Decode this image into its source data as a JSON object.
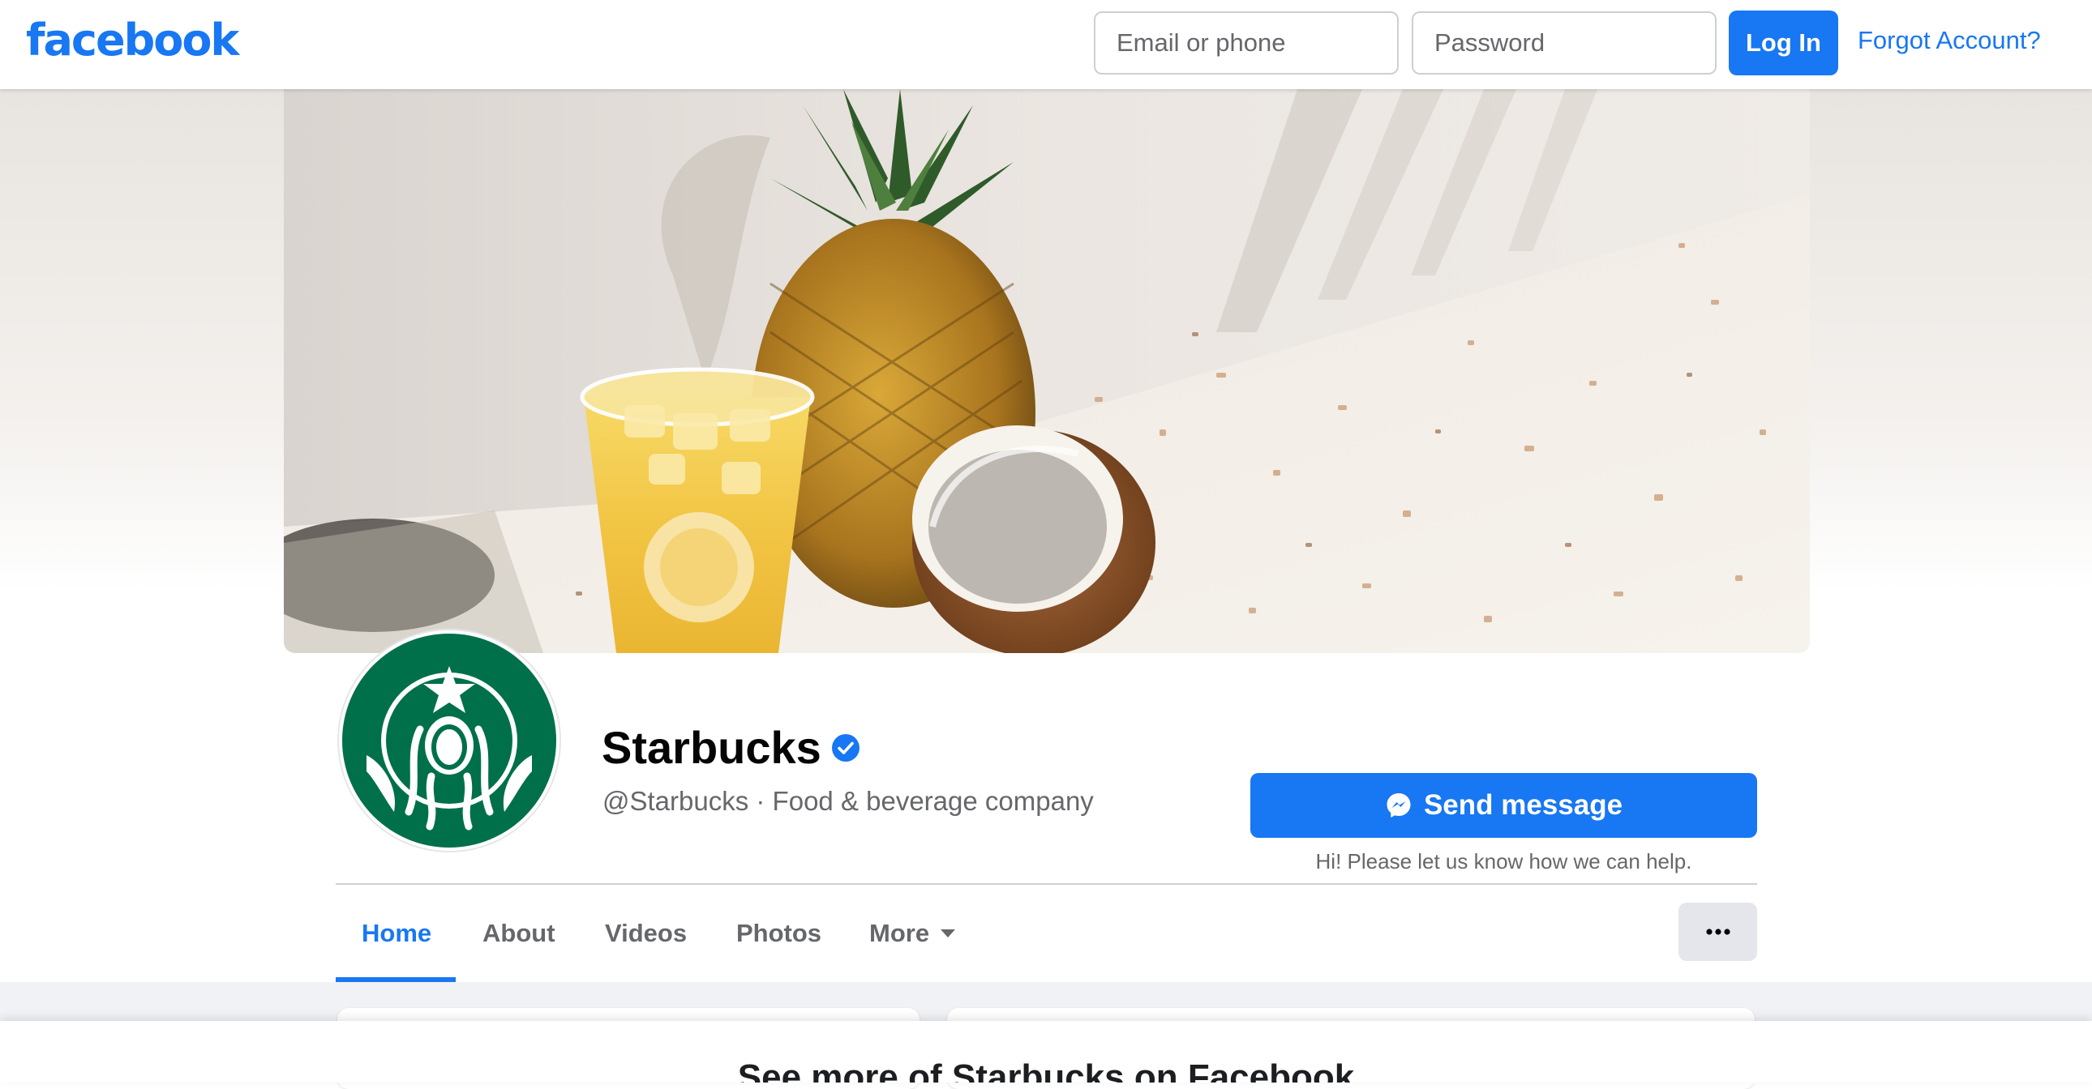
{
  "header": {
    "logo": "facebook",
    "email_placeholder": "Email or phone",
    "password_placeholder": "Password",
    "login_label": "Log In",
    "forgot_label": "Forgot Account?"
  },
  "profile": {
    "name": "Starbucks",
    "verified": true,
    "subtitle": "@Starbucks · Food & beverage company",
    "send_message_label": "Send message",
    "help_text": "Hi! Please let us know how we can help."
  },
  "tabs": [
    {
      "label": "Home",
      "active": true
    },
    {
      "label": "About",
      "active": false
    },
    {
      "label": "Videos",
      "active": false
    },
    {
      "label": "Photos",
      "active": false
    },
    {
      "label": "More",
      "active": false
    }
  ],
  "icons": {
    "messenger": "messenger-icon",
    "verified": "verified-badge-icon",
    "more_caret": "caret-down-icon",
    "options": "more-options-icon"
  },
  "colors": {
    "brand_blue": "#1877f2",
    "starbucks_green": "#00704a",
    "text_secondary": "#65676b"
  },
  "login_overlay": {
    "title": "See more of Starbucks on Facebook"
  }
}
